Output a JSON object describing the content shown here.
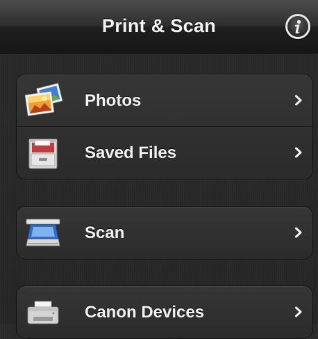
{
  "navbar": {
    "title": "Print & Scan",
    "info_icon": "info-icon"
  },
  "groups": [
    {
      "rows": [
        {
          "label": "Photos",
          "icon": "photos-icon"
        },
        {
          "label": "Saved Files",
          "icon": "file-cabinet-icon"
        }
      ]
    },
    {
      "rows": [
        {
          "label": "Scan",
          "icon": "scanner-icon"
        }
      ]
    },
    {
      "rows": [
        {
          "label": "Canon Devices",
          "icon": "printer-icon"
        }
      ]
    }
  ],
  "colors": {
    "background": "#282828",
    "text": "#f2f2f2",
    "navbar_top": "#4d4d4d",
    "navbar_bottom": "#161616"
  }
}
